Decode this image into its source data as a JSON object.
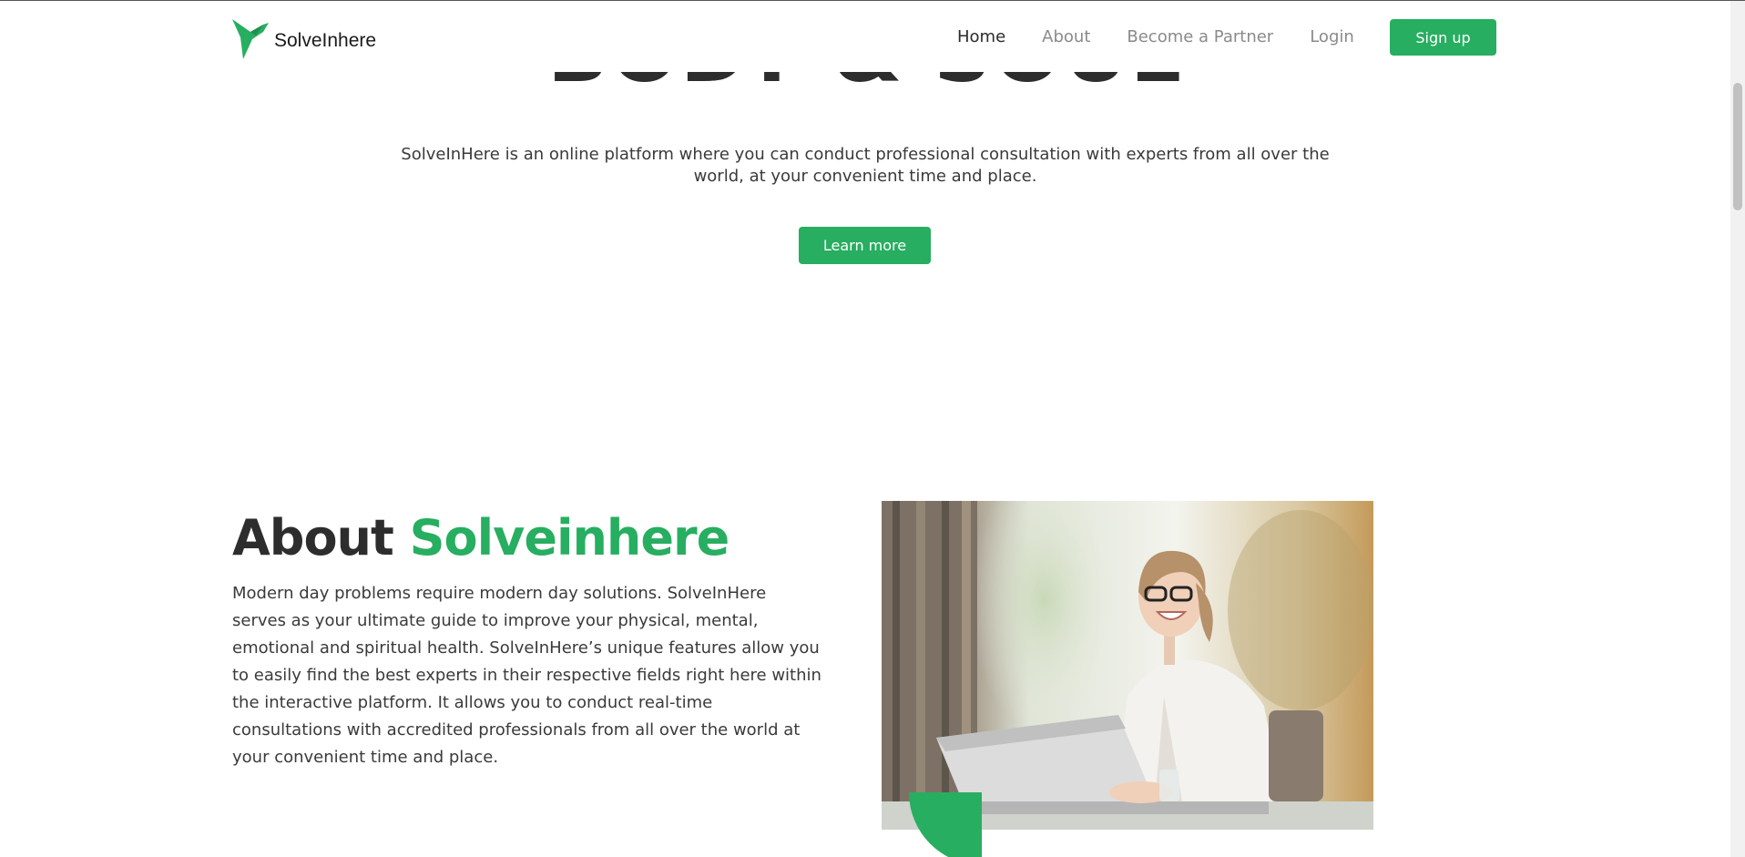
{
  "brand": {
    "name": "SolveInhere",
    "accent_color": "#27ae60",
    "logo_icon": "hummingbird-logo-icon"
  },
  "nav": {
    "items": [
      {
        "label": "Home",
        "active": true
      },
      {
        "label": "About",
        "active": false
      },
      {
        "label": "Become a Partner",
        "active": false
      },
      {
        "label": "Login",
        "active": false
      }
    ],
    "signup_label": "Sign up"
  },
  "hero": {
    "title": "BODY & SOUL",
    "description": "SolveInHere is an online platform where you can conduct professional consultation with experts from all over the world, at your convenient time and place.",
    "cta_label": "Learn more"
  },
  "about": {
    "title_prefix": "About",
    "title_accent": "Solveinhere",
    "body": "Modern day problems require modern day solutions. SolveInHere serves as your ultimate guide to improve your physical, mental, emotional and spiritual health. SolveInHere’s unique features allow you to easily find the best experts in their respective fields right here within the interactive platform. It allows you to conduct real-time consultations with accredited professionals from all over the world at your convenient time and place."
  }
}
